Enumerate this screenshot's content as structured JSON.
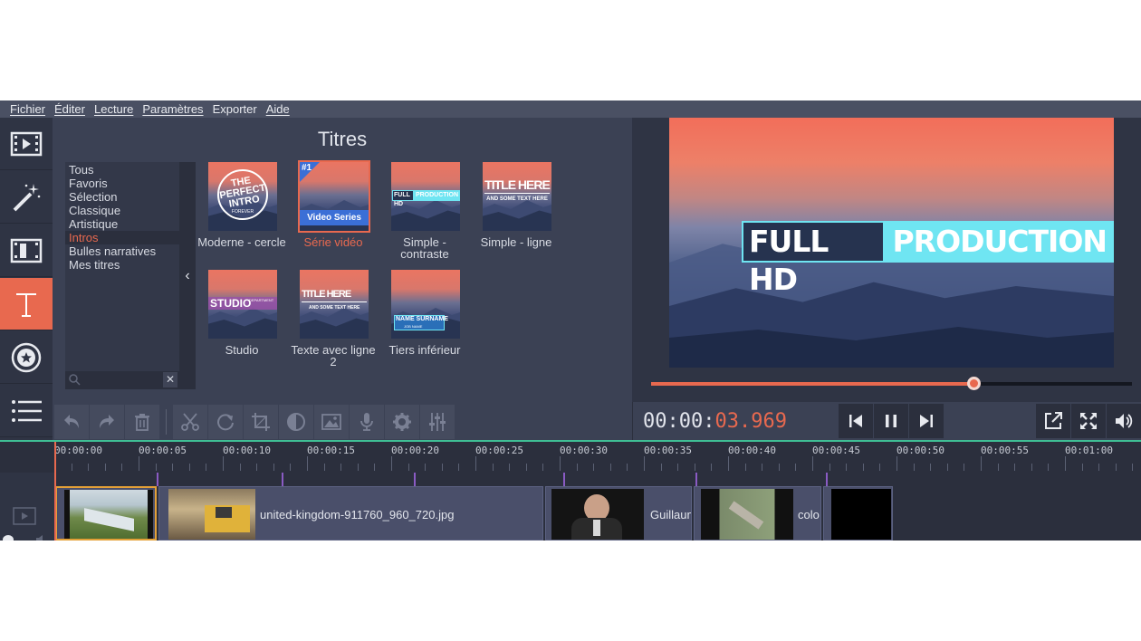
{
  "menu": [
    "Fichier",
    "Éditer",
    "Lecture",
    "Paramètres",
    "Exporter",
    "Aide"
  ],
  "left_tools": [
    "film-import-icon",
    "magic-wand-icon",
    "filter-icon",
    "titles-icon",
    "sticker-icon",
    "list-menu-icon"
  ],
  "panel": {
    "title": "Titres",
    "categories": [
      "Tous",
      "Favoris",
      "Sélection",
      "Classique",
      "Artistique",
      "Intros",
      "Bulles narratives",
      "Mes titres"
    ],
    "selected_category": "Intros",
    "collapse_glyph": "‹",
    "search_clear": "✕"
  },
  "thumbnails": [
    {
      "label": "Moderne - cercle",
      "text": "THE PERFECT INTRO",
      "sub": "FOREVER"
    },
    {
      "label": "Série vidéo",
      "text": "Video Series",
      "badge": "#1",
      "selected": true
    },
    {
      "label": "Simple - contraste",
      "text": "FULL HD",
      "text2": "PRODUCTION"
    },
    {
      "label": "Simple - ligne",
      "text": "TITLE HERE",
      "sub": "AND SOME TEXT HERE"
    },
    {
      "label": "Studio",
      "text": "STUDIO",
      "sub": "DEPARTMENT"
    },
    {
      "label": "Texte avec ligne 2",
      "text": "TITLE HERE",
      "sub": "AND SOME TEXT HERE"
    },
    {
      "label": "Tiers inférieur",
      "text": "NAME SURNAME",
      "sub": "JOB NAME"
    }
  ],
  "preview": {
    "title_left": "FULL HD",
    "title_right": "PRODUCTION",
    "progress": 0.67
  },
  "timecode": {
    "main": "00:00:",
    "fraction": "03.969"
  },
  "edit_tools": [
    "undo-icon",
    "redo-icon",
    "delete-icon",
    "cut-icon",
    "rotate-icon",
    "crop-icon",
    "color-adjust-icon",
    "image-icon",
    "microphone-icon",
    "settings-icon",
    "equalizer-icon"
  ],
  "playback": [
    "skip-back-icon",
    "pause-icon",
    "skip-forward-icon",
    "export-icon",
    "fullscreen-icon",
    "volume-icon"
  ],
  "ruler_labels": [
    "00:00:00",
    "00:00:05",
    "00:00:10",
    "00:00:15",
    "00:00:20",
    "00:00:25",
    "00:00:30",
    "00:00:35",
    "00:00:40",
    "00:00:45",
    "00:00:50",
    "00:00:55",
    "00:01:00"
  ],
  "clips": [
    {
      "name": ""
    },
    {
      "name": "united-kingdom-911760_960_720.jpg"
    },
    {
      "name": "Guillaum"
    },
    {
      "name": "colo"
    },
    {
      "name": ""
    }
  ],
  "colors": {
    "accent": "#e8694f",
    "panel": "#3b4154",
    "dark": "#2b2f3d",
    "cyan": "#6fe5f2",
    "timeline_line": "#3fbf95"
  }
}
